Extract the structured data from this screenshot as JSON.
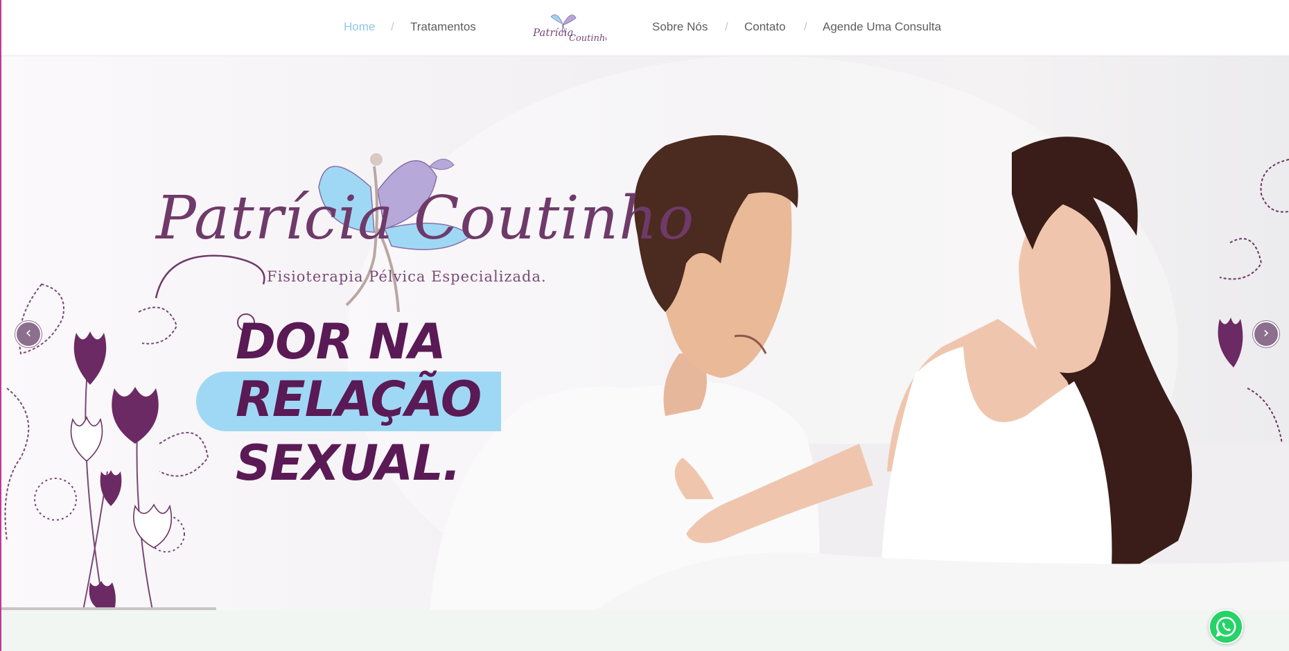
{
  "nav": {
    "items_left": [
      {
        "label": "Home",
        "active": true
      },
      {
        "label": "Tratamentos",
        "active": false
      }
    ],
    "items_right": [
      {
        "label": "Sobre Nós"
      },
      {
        "label": "Contato"
      },
      {
        "label": "Agende Uma Consulta"
      }
    ],
    "separator": "/",
    "logo": {
      "text_line1": "Patrícia",
      "text_line2": "Coutinho"
    }
  },
  "hero": {
    "brand_name": "Patrícia Coutinho",
    "brand_tagline": "Fisioterapia Pélvica Especializada.",
    "headline_line1": "DOR NA",
    "headline_line2": "RELAÇÃO",
    "headline_line3": "SEXUAL.",
    "prev_arrow": "‹",
    "next_arrow": "›",
    "slide_progress": 0.17
  },
  "icons": {
    "prev": "chevron-left-icon",
    "next": "chevron-right-icon",
    "whatsapp": "whatsapp-icon"
  },
  "colors": {
    "nav_active": "#8ec9ea",
    "headline": "#5a1a55",
    "highlight": "#9fd8f5",
    "whatsapp": "#25d366",
    "accent": "#c2369a"
  }
}
